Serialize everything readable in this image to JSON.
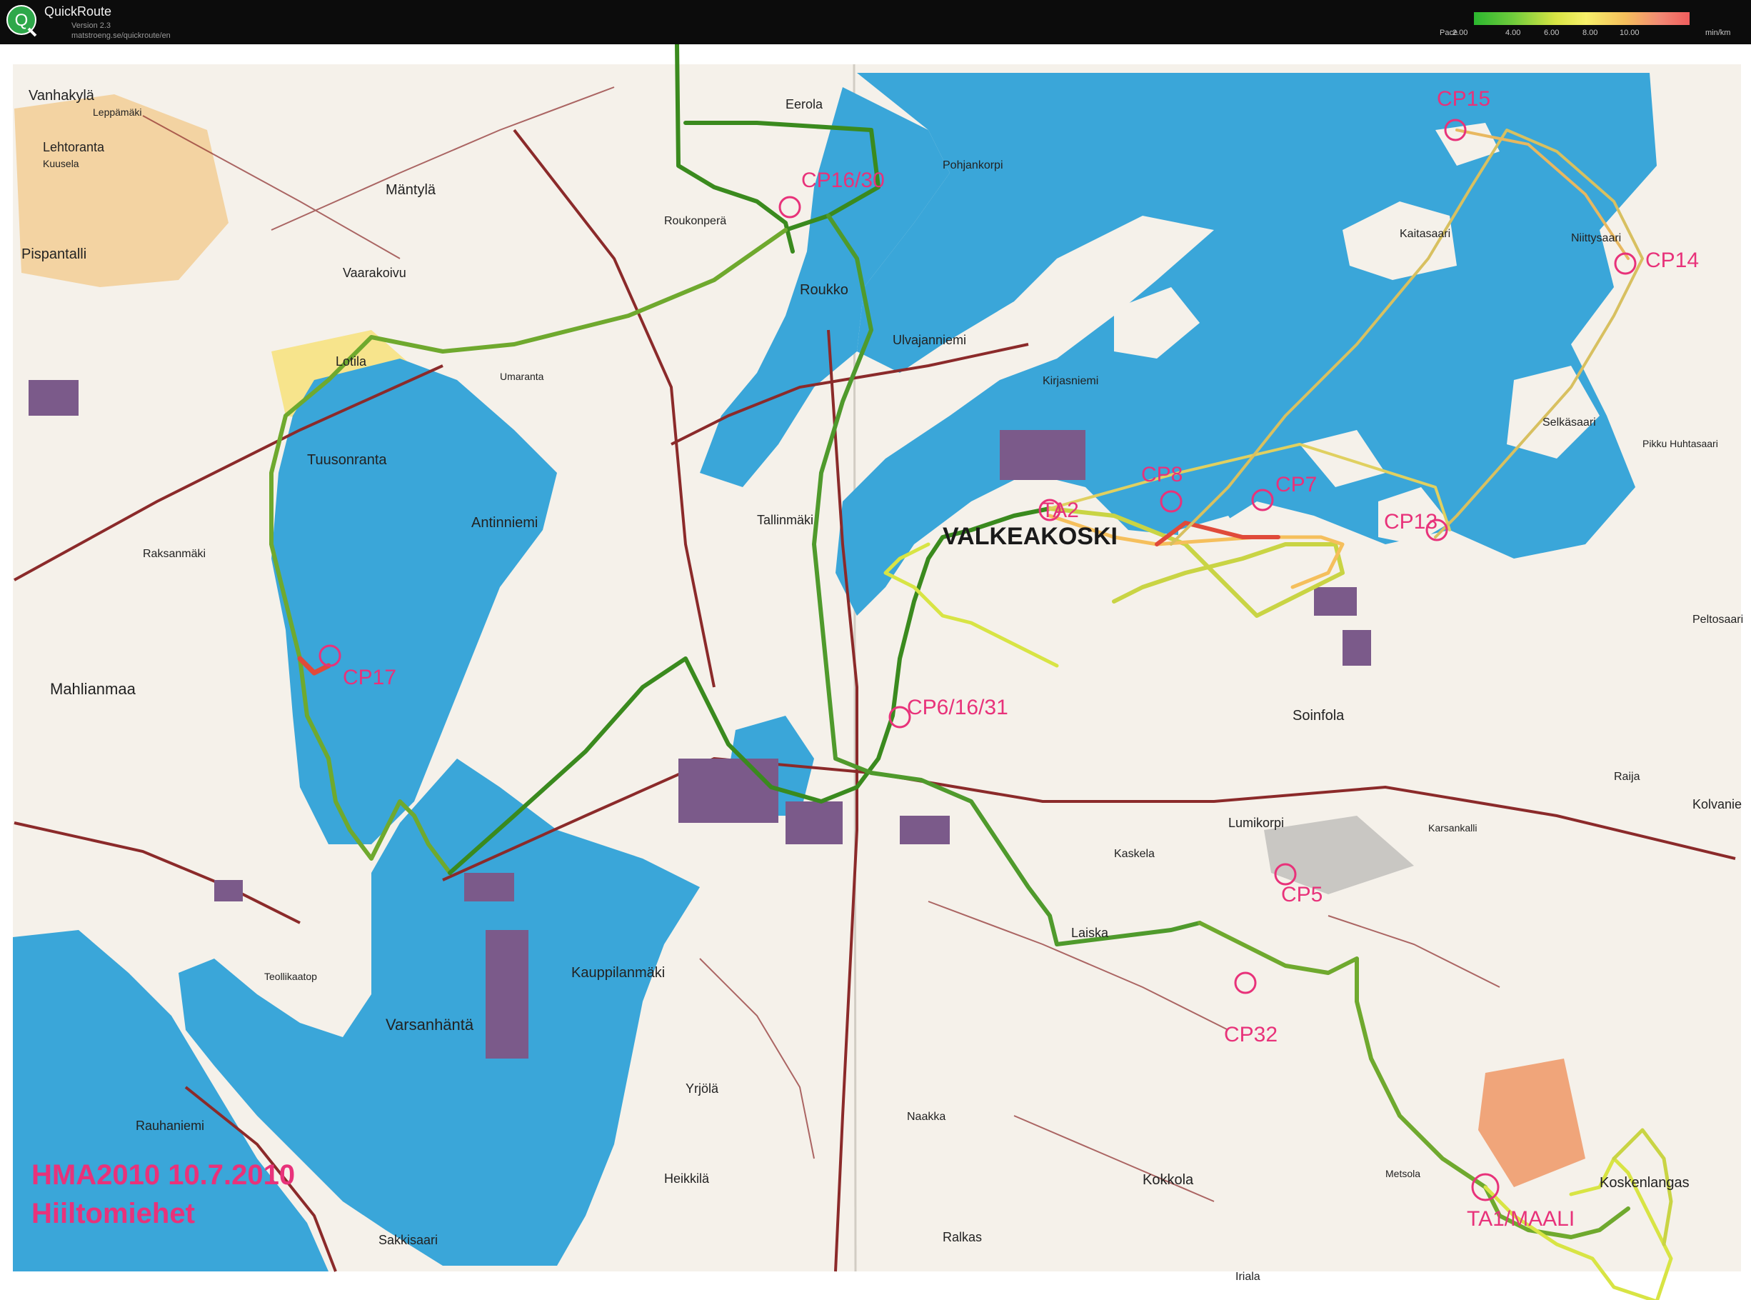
{
  "app": {
    "name": "QuickRoute",
    "version": "Version 2.3",
    "url": "matstroeng.se/quickroute/en"
  },
  "legend": {
    "label": "Pace",
    "ticks": [
      "2.00",
      "4.00",
      "6.00",
      "8.00",
      "10.00"
    ],
    "unit": "min/km",
    "colors": [
      "#2bb72f",
      "#d8e444",
      "#f5bf5c",
      "#f05d5d"
    ]
  },
  "colors": {
    "water": "#3aa6d9",
    "route_fast": "#3a8a1e",
    "route_slow": "#e04a3a",
    "control": "#e8327a",
    "road": "#8b2a2a"
  },
  "controls": {
    "cp15": "CP15",
    "cp14": "CP14",
    "cp13": "CP13",
    "cp7": "CP7",
    "cp8": "CP8",
    "ta2": "TA2",
    "cp17": "CP17",
    "cp16": "CP16/30",
    "cp6": "CP6/16/31",
    "cp5": "CP5",
    "cp32": "CP32",
    "ta1": "TA1/MAALI"
  },
  "places": {
    "valkeakoski": "VALKEAKOSKI",
    "vanhakyla": "Vanhakylä",
    "leppamaki": "Leppämäki",
    "lehtoranta": "Lehtoranta",
    "kuusela": "Kuusela",
    "mantyla": "Mäntylä",
    "pispantalli": "Pispantalli",
    "vaarakoivu": "Vaarakoivu",
    "roukonpera": "Roukonperä",
    "roukko": "Roukko",
    "eerola": "Eerola",
    "pohjankorpi": "Pohjankorpi",
    "ulvajanniemi": "Ulvajanniemi",
    "kirjasniemi": "Kirjasniemi",
    "lotila": "Lotila",
    "umaranta": "Umaranta",
    "tuusonranta": "Tuusonranta",
    "antinniemi": "Antinniemi",
    "tallinmaki": "Tallinmäki",
    "raksanmaki": "Raksanmäki",
    "mahlianmaa": "Mahlianmaa",
    "soinfola": "Soinfola",
    "lumikorpi": "Lumikorpi",
    "kaskela": "Kaskela",
    "laiska": "Laiska",
    "kauppilanmaki": "Kauppilanmäki",
    "varsanhanta": "Varsanhäntä",
    "yrjola": "Yrjölä",
    "kokkola": "Kokkola",
    "heikkila": "Heikkilä",
    "naakka": "Naakka",
    "rauhaniemi": "Rauhaniemi",
    "sakkisaari": "Sakkisaari",
    "ralkas": "Ralkas",
    "iriala": "Iriala",
    "metsola": "Metsola",
    "koskenlangas": "Koskenlangas",
    "selkasaari": "Selkäsaari",
    "peltosaari": "Peltosaari",
    "kaitasaari": "Kaitasaari",
    "niittysaari": "Niittysaari",
    "kolvanie": "Kolvanie",
    "raija": "Raija",
    "karsankalli": "Karsankalli",
    "pikku_huhtasaari": "Pikku Huhtasaari",
    "teollikaatop": "Teollikaatop"
  },
  "event": {
    "title": "HMA2010 10.7.2010",
    "subtitle": "Hiiltomiehet"
  }
}
